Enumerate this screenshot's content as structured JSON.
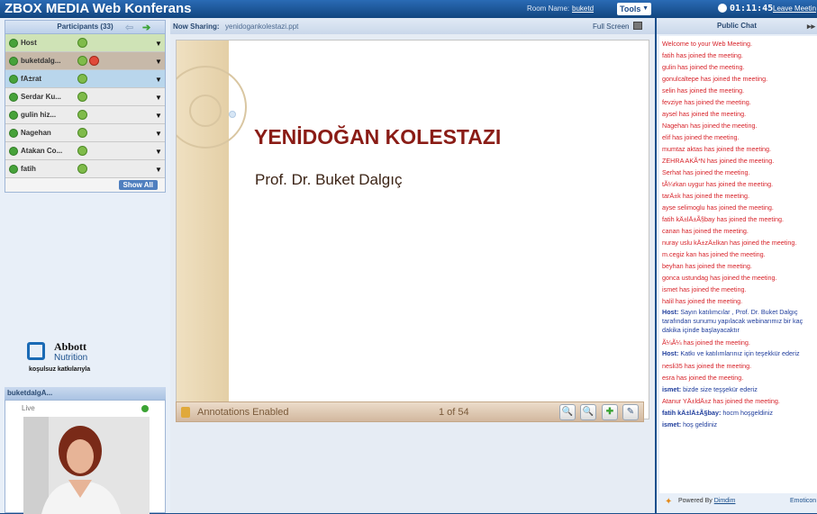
{
  "app": {
    "title": "ZBOX MEDIA Web Konferans",
    "room_label": "Room Name:",
    "room_name": "buketd",
    "tools_label": "Tools",
    "timer": "01:11:45",
    "leave_label": "Leave Meetin"
  },
  "participants": {
    "header": "Participants (33)",
    "items": [
      {
        "name": "Host",
        "style": "host"
      },
      {
        "name": "buketdalg...",
        "style": "pres"
      },
      {
        "name": "fA±rat",
        "style": "sel"
      },
      {
        "name": "Serdar Ku...",
        "style": ""
      },
      {
        "name": "gulin hiz...",
        "style": ""
      },
      {
        "name": "Nagehan",
        "style": ""
      },
      {
        "name": "Atakan Co...",
        "style": ""
      },
      {
        "name": "fatih",
        "style": ""
      }
    ],
    "show_all": "Show All"
  },
  "sponsor": {
    "brand": "Abbott",
    "division": "Nutrition",
    "note": "koşulsuz katkılarıyla"
  },
  "camera": {
    "header": "buketdalgA...",
    "status": "Live"
  },
  "sharing": {
    "label": "Now Sharing:",
    "file": "yenidogankolestazi.ppt",
    "fullscreen": "Full Screen"
  },
  "slide": {
    "title": "YENİDOĞAN KOLESTAZI",
    "subtitle": "Prof. Dr. Buket Dalgıç"
  },
  "annotation": {
    "label": "Annotations Enabled",
    "page": "1 of 54"
  },
  "chat": {
    "header": "Public Chat",
    "messages": [
      {
        "sender": "",
        "text": "Welcome to your Web Meeting.",
        "kind": "system"
      },
      {
        "sender": "",
        "text": "fatih has joined the meeting.",
        "kind": "system"
      },
      {
        "sender": "",
        "text": "gulin has joined the meeting.",
        "kind": "system"
      },
      {
        "sender": "",
        "text": "gonulcaltepe has joined the meeting.",
        "kind": "system"
      },
      {
        "sender": "",
        "text": "selin has joined the meeting.",
        "kind": "system"
      },
      {
        "sender": "",
        "text": "fevziye has joined the meeting.",
        "kind": "system"
      },
      {
        "sender": "",
        "text": "aysel has joined the meeting.",
        "kind": "system"
      },
      {
        "sender": "",
        "text": "Nagehan has joined the meeting.",
        "kind": "system"
      },
      {
        "sender": "",
        "text": "elif has joined the meeting.",
        "kind": "system"
      },
      {
        "sender": "",
        "text": "mumtaz aktas has joined the meeting.",
        "kind": "system"
      },
      {
        "sender": "",
        "text": "ZEHRA AKÃ*N has joined the meeting.",
        "kind": "system"
      },
      {
        "sender": "",
        "text": "Serhat has joined the meeting.",
        "kind": "system"
      },
      {
        "sender": "",
        "text": "tÃ¼rkan uygur has joined the meeting.",
        "kind": "system"
      },
      {
        "sender": "",
        "text": "tarÄ±k has joined the meeting.",
        "kind": "system"
      },
      {
        "sender": "",
        "text": "ayse selimoglu has joined the meeting.",
        "kind": "system"
      },
      {
        "sender": "",
        "text": "fatih kÄ±lÄ±Ã§bay has joined the meeting.",
        "kind": "system"
      },
      {
        "sender": "",
        "text": "canan has joined the meeting.",
        "kind": "system"
      },
      {
        "sender": "",
        "text": "nuray uslu kÄ±zÄ±lkan has joined the meeting.",
        "kind": "system"
      },
      {
        "sender": "",
        "text": "m.cegiz kan has joined the meeting.",
        "kind": "system"
      },
      {
        "sender": "",
        "text": "beyhan has joined the meeting.",
        "kind": "system"
      },
      {
        "sender": "",
        "text": "gonca ustundag has joined the meeting.",
        "kind": "system"
      },
      {
        "sender": "",
        "text": "ismet has joined the meeting.",
        "kind": "system"
      },
      {
        "sender": "",
        "text": "halil has joined the meeting.",
        "kind": "system"
      },
      {
        "sender": "Host:",
        "text": "Sayın katılımcılar , Prof. Dr. Buket Dalgıç tarafından sunumu yapılacak webinarımız bir kaç dakika içinde başlayacaktır",
        "kind": "user"
      },
      {
        "sender": "",
        "text": "Ã¼Ã¼ has joined the meeting.",
        "kind": "system"
      },
      {
        "sender": "Host:",
        "text": "Katkı ve katılımlarınız için teşekkür ederiz",
        "kind": "user"
      },
      {
        "sender": "",
        "text": "nesli35 has joined the meeting.",
        "kind": "system"
      },
      {
        "sender": "",
        "text": "esra has joined the meeting.",
        "kind": "system"
      },
      {
        "sender": "ismet:",
        "text": "bizde size teşşekür ederiz",
        "kind": "user"
      },
      {
        "sender": "",
        "text": "Atanur YÄ±ldÄ±z has joined the meeting.",
        "kind": "system"
      },
      {
        "sender": "fatih kÄ±lÄ±Ã§bay:",
        "text": "hocm hoşgeldiniz",
        "kind": "user"
      },
      {
        "sender": "ismet:",
        "text": "hoş geldiniz",
        "kind": "user"
      }
    ],
    "powered_by": "Powered By",
    "powered_link": "Dimdim",
    "emoticons": "Emoticon"
  }
}
